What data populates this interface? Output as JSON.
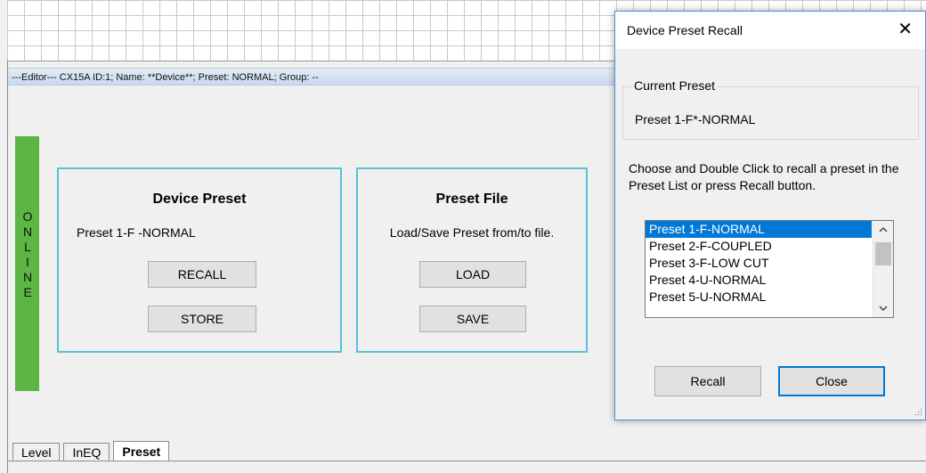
{
  "editor": {
    "status": "---Editor---  CX15A  ID:1;  Name: **Device**;  Preset: NORMAL;  Group: --"
  },
  "online_label": "ONLINE",
  "device_preset": {
    "title": "Device Preset",
    "current": "Preset  1-F -NORMAL",
    "recall_label": "RECALL",
    "store_label": "STORE"
  },
  "preset_file": {
    "title": "Preset File",
    "description": "Load/Save Preset from/to file.",
    "load_label": "LOAD",
    "save_label": "SAVE"
  },
  "tabs": [
    {
      "label": "Level"
    },
    {
      "label": "InEQ"
    },
    {
      "label": "Preset"
    }
  ],
  "dialog": {
    "title": "Device Preset Recall",
    "close_glyph": "✕",
    "group_label": "Current Preset",
    "current_value": "Preset  1-F*-NORMAL",
    "instructions": "Choose and Double Click to recall a preset in the Preset List or press Recall button.",
    "list": [
      "Preset  1-F-NORMAL",
      "Preset  2-F-COUPLED",
      "Preset  3-F-LOW CUT",
      "Preset  4-U-NORMAL",
      "Preset  5-U-NORMAL"
    ],
    "recall_label": "Recall",
    "close_label": "Close"
  },
  "colors": {
    "online": "#5db543",
    "panel_border": "#57c3d4",
    "selection": "#0078d7"
  },
  "icons": {
    "scroll_up": "chevron-up-icon",
    "scroll_down": "chevron-down-icon",
    "resize": "resize-grip-icon"
  }
}
